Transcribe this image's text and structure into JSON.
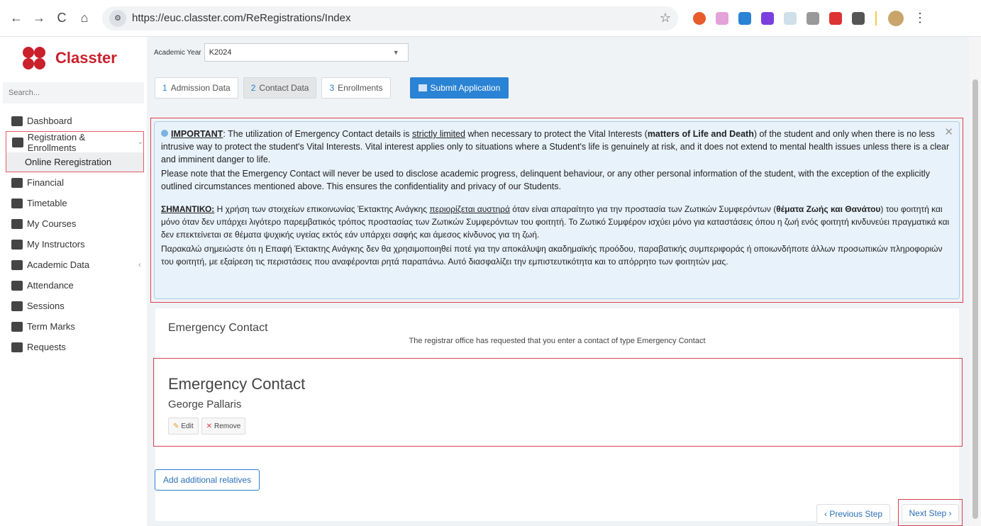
{
  "browser": {
    "url": "https://euc.classter.com/ReRegistrations/Index",
    "back_icon": "←",
    "forward_icon": "→",
    "reload_icon": "C",
    "home_icon": "⌂",
    "site_icon": "⚙",
    "star_icon": "☆",
    "menu_icon": "⋮"
  },
  "brand": {
    "name": "Classter"
  },
  "sidebar": {
    "search_placeholder": "Search...",
    "items": [
      {
        "label": "Dashboard"
      },
      {
        "label": "Registration & Enrollments"
      },
      {
        "label": "Online Reregistration"
      },
      {
        "label": "Financial"
      },
      {
        "label": "Timetable"
      },
      {
        "label": "My Courses"
      },
      {
        "label": "My Instructors"
      },
      {
        "label": "Academic Data"
      },
      {
        "label": "Attendance"
      },
      {
        "label": "Sessions"
      },
      {
        "label": "Term Marks"
      },
      {
        "label": "Requests"
      }
    ],
    "collapse_icon": "‹",
    "group_chevron": "⌄"
  },
  "header": {
    "year_label": "Academic Year",
    "year_value": "K2024",
    "year_caret": "▼"
  },
  "steps": [
    {
      "num": "1",
      "label": "Admission Data"
    },
    {
      "num": "2",
      "label": "Contact Data"
    },
    {
      "num": "3",
      "label": "Enrollments"
    }
  ],
  "submit_label": "Submit Application",
  "alert": {
    "close": "✕",
    "en_strong": "IMPORTANT",
    "en_p1a": ": The utilization of Emergency Contact details is ",
    "en_p1u": "strictly limited",
    "en_p1b": " when necessary to protect the Vital Interests (",
    "en_p1bold": "matters of Life and Death",
    "en_p1c": ") of the student and only when there is no less intrusive way to protect the student's Vital Interests. Vital interest applies only to situations where a Student's life is genuinely at risk, and it does not extend to mental health issues unless there is a clear and imminent danger to life.",
    "en_p2": "Please note that the Emergency Contact will never be used to disclose academic progress, delinquent behaviour, or any other personal information of the student, with the exception of the explicitly outlined circumstances mentioned above. This ensures the confidentiality and privacy of our Students.",
    "gr_strong": "ΣΗΜΑΝΤΙΚΟ:",
    "gr_p1a": " Η χρήση των στοιχείων επικοινωνίας Έκτακτης Ανάγκης ",
    "gr_p1u": "περιορίζεται αυστηρά",
    "gr_p1b": " όταν είναι απαραίτητο για την προστασία των Ζωτικών Συμφερόντων (",
    "gr_p1bold": "θέματα Ζωής και Θανάτου",
    "gr_p1c": ") του φοιτητή και μόνο όταν δεν υπάρχει λιγότερο παρεμβατικός τρόπος προστασίας των Ζωτικών Συμφερόντων του φοιτητή. Το Ζωτικό Συμφέρον ισχύει μόνο για καταστάσεις όπου η ζωή ενός φοιτητή κινδυνεύει πραγματικά και δεν επεκτείνεται σε θέματα ψυχικής υγείας εκτός εάν υπάρχει σαφής και άμεσος κίνδυνος για τη ζωή.",
    "gr_p2": "Παρακαλώ σημειώστε ότι η Επαφή Έκτακτης Ανάγκης δεν θα χρησιμοποιηθεί ποτέ για την αποκάλυψη ακαδημαϊκής προόδου, παραβατικής συμπεριφοράς ή οποιωνδήποτε άλλων προσωπικών πληροφοριών του φοιτητή, με εξαίρεση τις περιστάσεις που αναφέρονται ρητά παραπάνω. Αυτό διασφαλίζει την εμπιστευτικότητα και το απόρρητο των φοιτητών μας."
  },
  "emergency": {
    "heading": "Emergency Contact",
    "note": "The registrar office has requested that you enter a contact of type Emergency Contact",
    "card_title": "Emergency Contact",
    "name": "George Pallaris",
    "edit_label": "Edit",
    "edit_icon": "✎",
    "remove_label": "Remove",
    "remove_icon": "✕"
  },
  "add_relatives_label": "Add additional relatives",
  "prev_label": "‹ Previous Step",
  "next_label": "Next Step ›"
}
